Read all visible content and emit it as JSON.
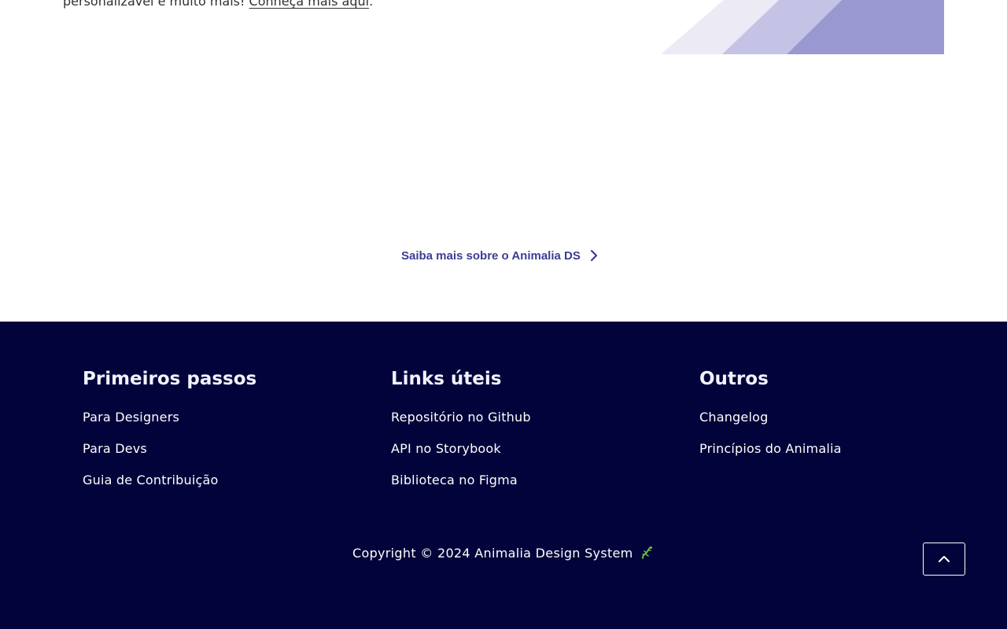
{
  "intro": {
    "partial_line": "personalizável e muito mais!",
    "link_text": "Conheça mais aqui",
    "trailing": "."
  },
  "saiba_mais": {
    "label": "Saiba mais sobre o Animalia DS",
    "icon": "chevron-right-icon"
  },
  "footer": {
    "columns": [
      {
        "title": "Primeiros passos",
        "links": [
          "Para Designers",
          "Para Devs",
          "Guia de Contribuição"
        ]
      },
      {
        "title": "Links úteis",
        "links": [
          "Repositório no Github",
          "API no Storybook",
          "Biblioteca no Figma"
        ]
      },
      {
        "title": "Outros",
        "links": [
          "Changelog",
          "Princípios do Animalia"
        ]
      }
    ],
    "copyright": "Copyright © 2024 Animalia Design System",
    "copyright_icon": "lizard-icon",
    "back_to_top_icon": "chevron-up-icon"
  },
  "colors": {
    "footer_bg": "#02033a",
    "link_accent": "#3d3d95",
    "stripe_light": "#ebeaf5",
    "stripe_mid": "#c4c3e6",
    "stripe_dark": "#9998d0"
  }
}
